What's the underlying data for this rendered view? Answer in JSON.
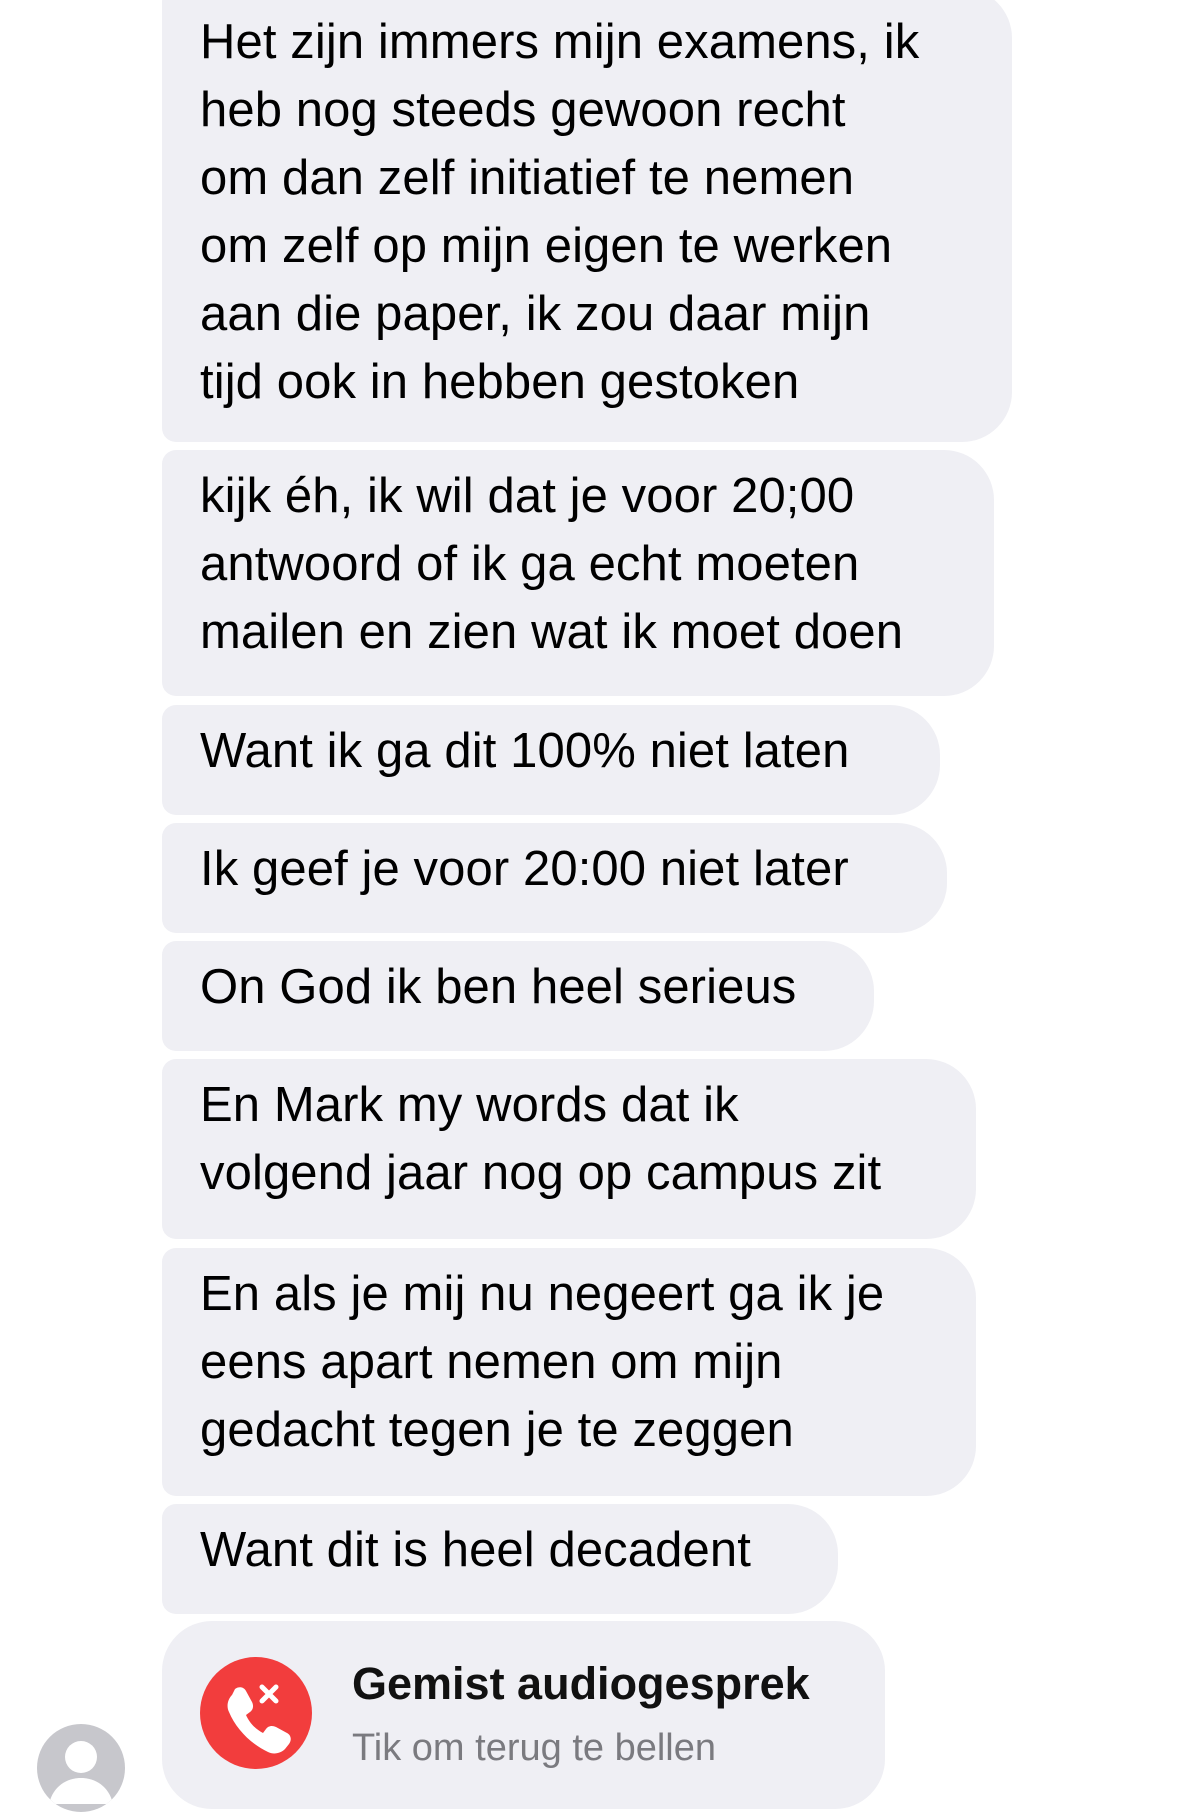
{
  "messages": [
    "Het zijn immers mijn examens, ik\nheb nog steeds gewoon recht\nom dan zelf initiatief te nemen\nom zelf op mijn eigen te werken\naan die paper, ik zou daar mijn\ntijd ook in hebben gestoken",
    "kijk éh, ik wil dat je voor 20;00\nantwoord of ik ga echt moeten\nmailen en zien wat ik moet doen",
    "Want ik ga dit 100% niet laten",
    "Ik geef je voor 20:00 niet later",
    "On God ik ben heel serieus",
    "En Mark my words dat ik\nvolgend jaar nog op campus zit",
    "En als je mij nu negeert ga ik je\neens apart nemen om mijn\ngedacht tegen je te zeggen",
    "Want dit is heel decadent"
  ],
  "missed_call": {
    "title": "Gemist audiogesprek",
    "subtitle": "Tik om terug te bellen",
    "icon": "missed-call-icon",
    "icon_color": "#f23d3d"
  },
  "sender": {
    "avatar_icon": "default-avatar-icon"
  },
  "colors": {
    "bubble_background": "#efeff4",
    "page_background": "#ffffff"
  }
}
